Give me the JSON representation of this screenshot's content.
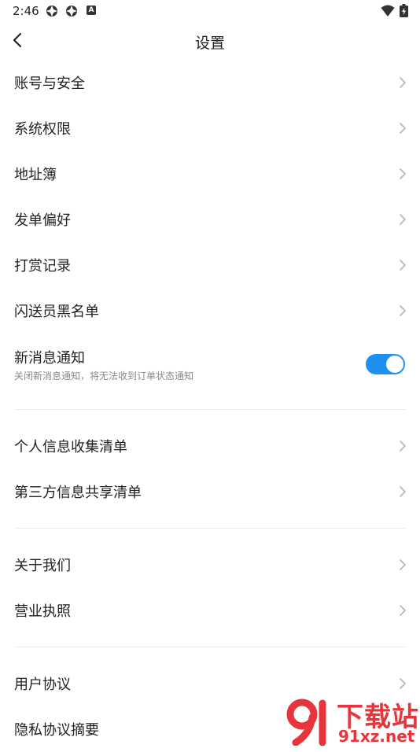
{
  "status_bar": {
    "time": "2:46",
    "icons": [
      "app-icon",
      "app-icon",
      "a-icon",
      "wifi-icon",
      "battery-icon"
    ]
  },
  "header": {
    "title": "设置",
    "back_icon": "chevron-left-icon"
  },
  "settings": {
    "group1": [
      {
        "label": "账号与安全"
      },
      {
        "label": "系统权限"
      },
      {
        "label": "地址簿"
      },
      {
        "label": "发单偏好"
      },
      {
        "label": "打赏记录"
      },
      {
        "label": "闪送员黑名单"
      }
    ],
    "notification": {
      "title": "新消息通知",
      "subtitle": "关闭新消息通知，将无法收到订单状态通知",
      "enabled": true
    },
    "group2": [
      {
        "label": "个人信息收集清单"
      },
      {
        "label": "第三方信息共享清单"
      }
    ],
    "group3": [
      {
        "label": "关于我们"
      },
      {
        "label": "营业执照"
      }
    ],
    "group4": [
      {
        "label": "用户协议"
      },
      {
        "label": "隐私协议摘要"
      }
    ]
  },
  "watermark": {
    "top": "下载站",
    "bottom": "91xz.net"
  },
  "colors": {
    "accent": "#1f8ff0",
    "text": "#222222",
    "subtext": "#8a8a8a",
    "chevron": "#b5b5b5",
    "divider": "#ececec",
    "watermark": "#e6353d"
  }
}
